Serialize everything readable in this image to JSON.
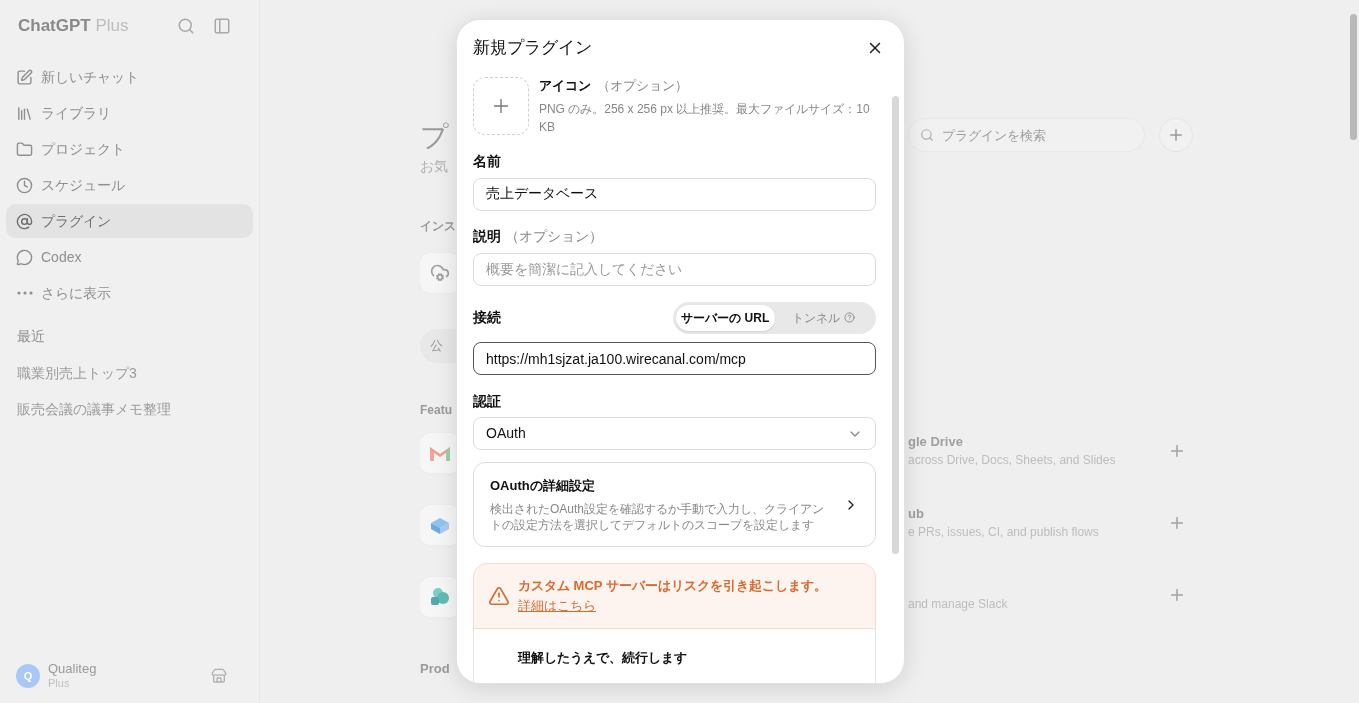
{
  "sidebar": {
    "brand": "ChatGPT",
    "plan": "Plus",
    "nav": [
      {
        "label": "新しいチャット",
        "selected": false
      },
      {
        "label": "ライブラリ",
        "selected": false
      },
      {
        "label": "プロジェクト",
        "selected": false
      },
      {
        "label": "スケジュール",
        "selected": false
      },
      {
        "label": "プラグイン",
        "selected": true
      },
      {
        "label": "Codex",
        "selected": false
      },
      {
        "label": "さらに表示",
        "selected": false
      }
    ],
    "recent_heading": "最近",
    "recent": [
      "職業別売上トップ3",
      "販売会議の議事メモ整理"
    ],
    "user": {
      "avatar": "Q",
      "name": "Qualiteg",
      "plan": "Plus"
    }
  },
  "background": {
    "heading": "プ",
    "subtitle": "お気",
    "installed_heading": "インス",
    "chip": "公",
    "featured_heading": "Featu",
    "products_heading": "Prod",
    "search": {
      "placeholder": "プラグインを検索"
    },
    "featured": [
      {
        "title": "gle Drive",
        "description": "across Drive, Docs, Sheets, and Slides"
      },
      {
        "title": "ub",
        "description": "e PRs, issues, CI, and publish flows"
      },
      {
        "description": "and manage Slack"
      }
    ]
  },
  "dialog": {
    "title": "新規プラグイン",
    "icon_upload": {
      "label": "アイコン",
      "optional": "（オプション）",
      "hint": "PNG のみ。256 x 256 px 以上推奨。最大ファイルサイズ：10 KB"
    },
    "name": {
      "label": "名前",
      "value": "売上データベース"
    },
    "description": {
      "label": "説明",
      "optional": "（オプション）",
      "placeholder": "概要を簡潔に記入してください"
    },
    "connection": {
      "label": "接続",
      "options": [
        {
          "label": "サーバーの URL",
          "selected": true
        },
        {
          "label": "トンネル",
          "selected": false
        }
      ],
      "url": "https://mh1sjzat.ja100.wirecanal.com/mcp",
      "focused": true
    },
    "auth": {
      "label": "認証",
      "value": "OAuth"
    },
    "oauth_settings": {
      "title": "OAuthの詳細設定",
      "description": "検出されたOAuth設定を確認するか手動で入力し、クライアントの設定方法を選択してデフォルトのスコープを設定します"
    },
    "warning": {
      "text": "カスタム MCP サーバーはリスクを引き起こします。",
      "link": "詳細はこちら"
    },
    "acknowledge": {
      "title": "理解したうえで、続行します"
    }
  }
}
